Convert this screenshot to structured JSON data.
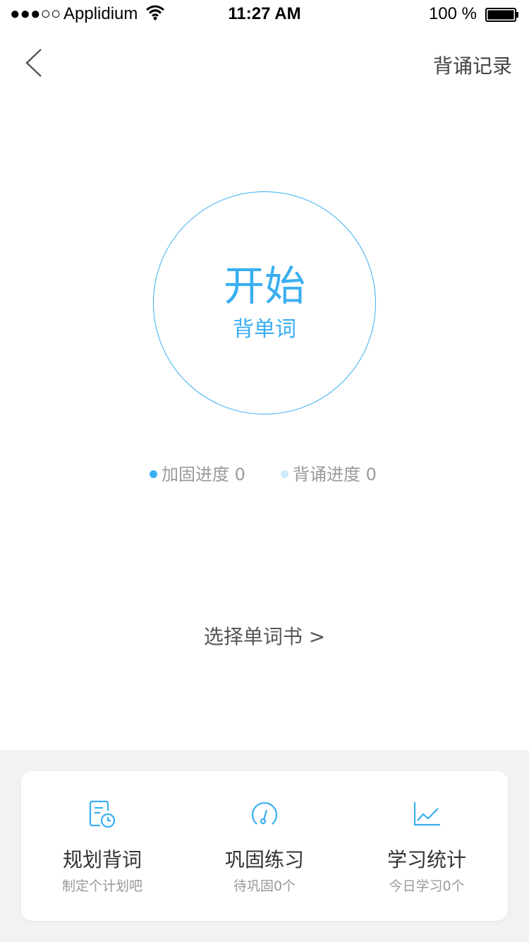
{
  "status_bar": {
    "signal": "●●●○○",
    "carrier": "Applidium",
    "time": "11:27 AM",
    "battery_percent": "100 %"
  },
  "nav": {
    "history_label": "背诵记录"
  },
  "start": {
    "main_label": "开始",
    "sub_label": "背单词",
    "accent_color": "#3aaef0"
  },
  "progress": {
    "consolidate_label": "加固进度 0",
    "consolidate_color": "#3aaef0",
    "recite_label": "背诵进度 0",
    "recite_color": "#cfeaf9"
  },
  "choose_book_label": "选择单词书 >",
  "actions": [
    {
      "title": "规划背词",
      "subtitle": "制定个计划吧",
      "icon": "plan-icon"
    },
    {
      "title": "巩固练习",
      "subtitle": "待巩固0个",
      "icon": "gauge-icon"
    },
    {
      "title": "学习统计",
      "subtitle": "今日学习0个",
      "icon": "chart-icon"
    }
  ]
}
